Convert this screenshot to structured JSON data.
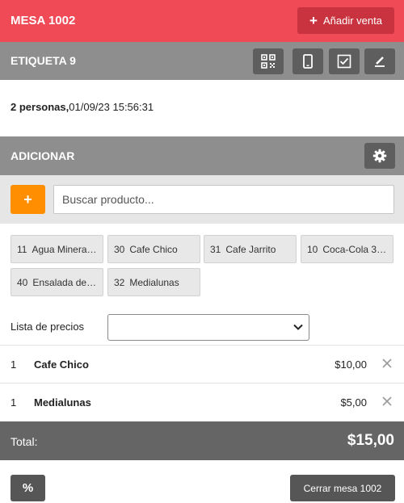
{
  "header": {
    "title": "MESA 1002",
    "add_sale_label": "Añadir venta"
  },
  "label_bar": {
    "title": "ETIQUETA 9",
    "tools": [
      "qr-code-icon",
      "mobile-icon",
      "checkbox-icon",
      "edit-icon"
    ]
  },
  "info": {
    "people": "2 personas,",
    "datetime": "01/09/23 15:56:31"
  },
  "add_section": {
    "title": "ADICIONAR",
    "settings_icon": "gear-icon"
  },
  "search": {
    "add_label": "+",
    "placeholder": "Buscar producto..."
  },
  "products": [
    {
      "code": "11",
      "name": "Agua Mineral ..."
    },
    {
      "code": "30",
      "name": "Cafe Chico"
    },
    {
      "code": "31",
      "name": "Cafe Jarrito"
    },
    {
      "code": "10",
      "name": "Coca-Cola 37..."
    },
    {
      "code": "40",
      "name": "Ensalada de ..."
    },
    {
      "code": "32",
      "name": "Medialunas"
    }
  ],
  "price_list": {
    "label": "Lista de precios",
    "value": ""
  },
  "order_lines": [
    {
      "qty": "1",
      "name": "Cafe Chico",
      "price": "$10,00"
    },
    {
      "qty": "1",
      "name": "Medialunas",
      "price": "$5,00"
    }
  ],
  "total": {
    "label": "Total:",
    "amount": "$15,00"
  },
  "footer": {
    "discount_label": "%",
    "close_label": "Cerrar mesa 1002"
  },
  "colors": {
    "header_red": "#f04a57",
    "add_button": "#c9333f",
    "grey_bar": "#8e8e8e",
    "orange": "#ff8f00",
    "total_bar": "#656565"
  }
}
